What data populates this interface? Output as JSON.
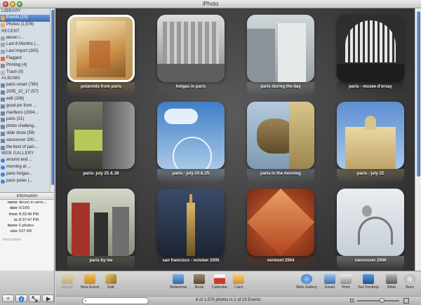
{
  "window": {
    "title": "iPhoto"
  },
  "sidebar": {
    "library_header": "LIBRARY",
    "library": [
      {
        "label": "Events (19)",
        "icon": "events-icon",
        "selected": true
      },
      {
        "label": "Photos (1,576)",
        "icon": "photos-icon"
      }
    ],
    "recent_header": "RECENT",
    "recent": [
      {
        "label": "devon i...",
        "icon": "album-icon"
      },
      {
        "label": "Last 6 Months (...",
        "icon": "calendar-icon"
      },
      {
        "label": "Last Import (163)",
        "icon": "import-icon"
      },
      {
        "label": "Flagged",
        "icon": "flag-icon"
      },
      {
        "label": "Printing (4)",
        "icon": "printer-icon"
      },
      {
        "label": "Trash (0)",
        "icon": "trash-icon"
      }
    ],
    "albums_header": "ALBUMS",
    "albums": [
      {
        "label": "paris smart (780)"
      },
      {
        "label": "2005_10_17 (57)"
      },
      {
        "label": "edit (106)"
      },
      {
        "label": "good pix from ..."
      },
      {
        "label": "marlboro (2004..."
      },
      {
        "label": "paris (21)"
      },
      {
        "label": "photo challeng..."
      },
      {
        "label": "slide show (59)"
      },
      {
        "label": "vancouver 200..."
      },
      {
        "label": "the best of pari..."
      }
    ],
    "web_header": "WEB GALLERY",
    "web": [
      {
        "label": "around and ..."
      },
      {
        "label": "morning at ..."
      },
      {
        "label": "paris holgas..."
      },
      {
        "label": "paris polas (..."
      }
    ]
  },
  "info": {
    "header": "Information",
    "rows": [
      {
        "k": "name",
        "v": "devon in verm..."
      },
      {
        "k": "date",
        "v": "5/1/05"
      },
      {
        "k": "from",
        "v": "8:33:49 PM"
      },
      {
        "k": "to",
        "v": "8:37:47 PM"
      },
      {
        "k": "items",
        "v": "6 photos"
      },
      {
        "k": "size",
        "v": "537 KB"
      }
    ],
    "description_placeholder": "description"
  },
  "events": [
    {
      "label": "polaroids from paris",
      "selected": true
    },
    {
      "label": "holgas in paris"
    },
    {
      "label": "paris during the day"
    },
    {
      "label": "paris - musee d'orsay"
    },
    {
      "label": "paris- july 25 & 26"
    },
    {
      "label": "paris - july 24 & 25"
    },
    {
      "label": "paris in the morning"
    },
    {
      "label": "paris - july 22"
    },
    {
      "label": "paris by lee"
    },
    {
      "label": "san francisco - october 2005"
    },
    {
      "label": "vermont 2004"
    },
    {
      "label": "vancouver 2006"
    }
  ],
  "toolbar": {
    "merge": "Merge",
    "new_event": "New Event",
    "edit": "Edit",
    "slideshow": "Slideshow",
    "book": "Book",
    "calendar": "Calendar",
    "card": "Card",
    "web_gallery": "Web Gallery",
    "email": "Email",
    "print": "Print",
    "set_desktop": "Set Desktop",
    "iweb": "iWeb",
    "burn": "Burn"
  },
  "status": {
    "text": "6 of 1,576 photos in 1 of 19 Events"
  },
  "colors": {
    "selection": "#3d6cb3",
    "background": "#333333"
  }
}
